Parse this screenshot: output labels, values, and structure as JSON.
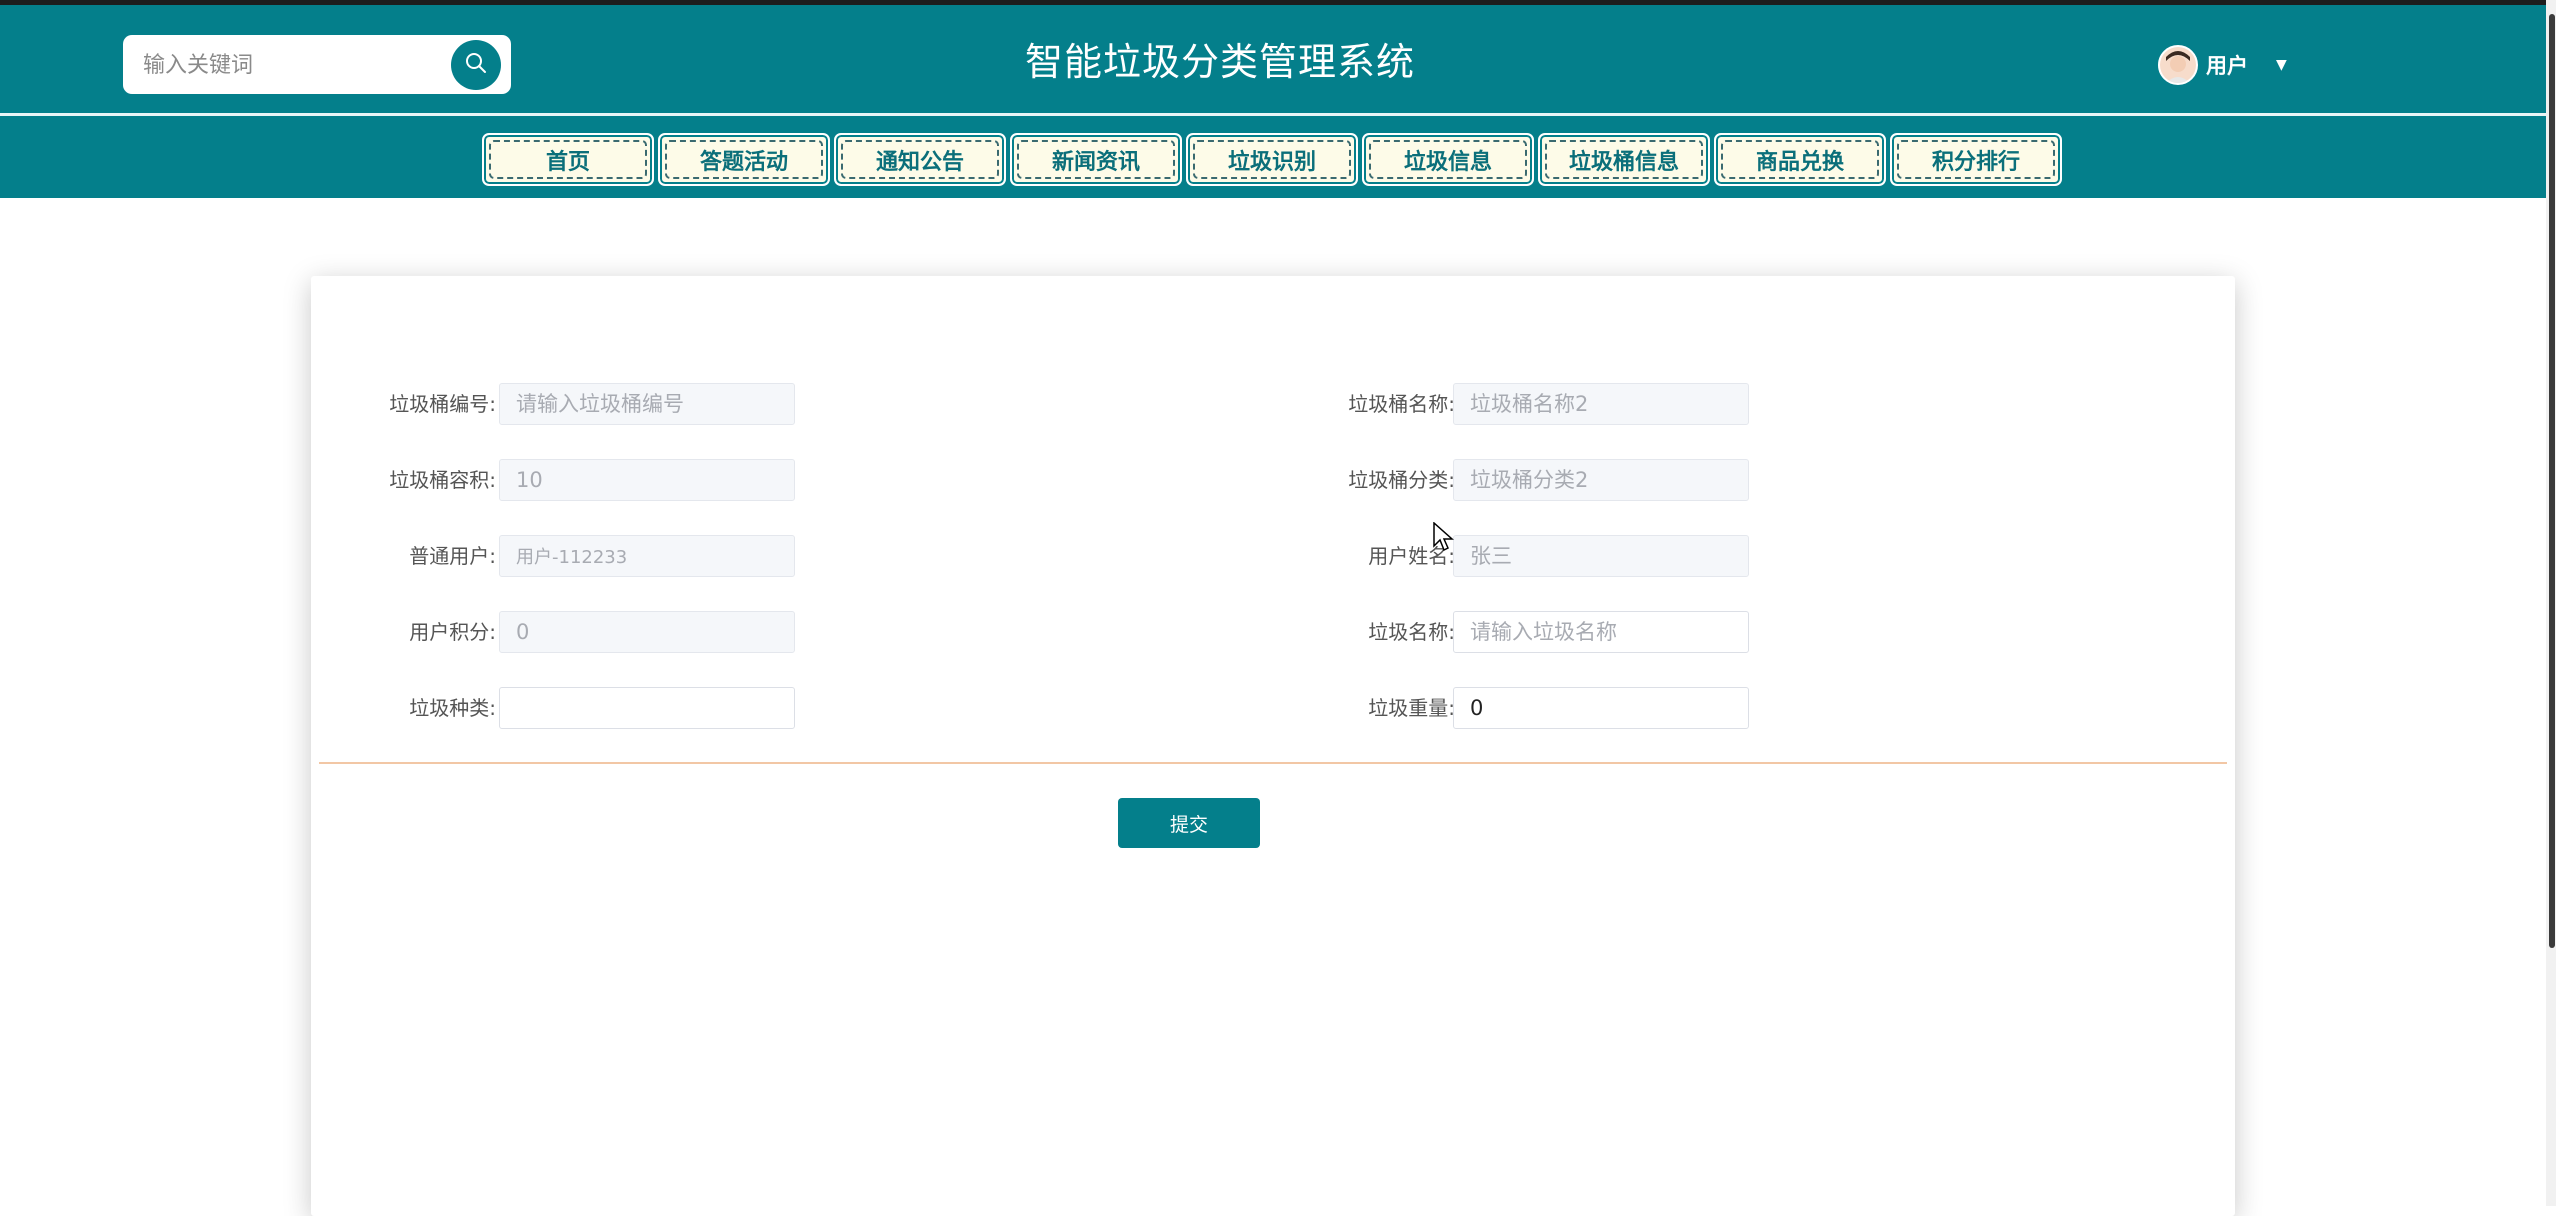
{
  "header": {
    "site_title": "智能垃圾分类管理系统",
    "search_placeholder": "输入关键词",
    "user_label": "用户",
    "brand_color": "#047f8b"
  },
  "nav": {
    "items": [
      {
        "label": "首页"
      },
      {
        "label": "答题活动"
      },
      {
        "label": "通知公告"
      },
      {
        "label": "新闻资讯"
      },
      {
        "label": "垃圾识别"
      },
      {
        "label": "垃圾信息"
      },
      {
        "label": "垃圾桶信息"
      },
      {
        "label": "商品兑换"
      },
      {
        "label": "积分排行"
      }
    ]
  },
  "form": {
    "bin_number": {
      "label": "垃圾桶编号:",
      "value": "",
      "placeholder": "请输入垃圾桶编号"
    },
    "bin_name": {
      "label": "垃圾桶名称:",
      "value": "",
      "placeholder": "垃圾桶名称2"
    },
    "bin_capacity": {
      "label": "垃圾桶容积:",
      "value": "10",
      "placeholder": ""
    },
    "bin_category": {
      "label": "垃圾桶分类:",
      "value": "",
      "placeholder": "垃圾桶分类2"
    },
    "regular_user": {
      "label": "普通用户:",
      "value": "用户-112233",
      "placeholder": ""
    },
    "user_name": {
      "label": "用户姓名:",
      "value": "",
      "placeholder": "张三"
    },
    "user_points": {
      "label": "用户积分:",
      "value": "0",
      "placeholder": ""
    },
    "garbage_name": {
      "label": "垃圾名称:",
      "value": "",
      "placeholder": "请输入垃圾名称"
    },
    "garbage_type": {
      "label": "垃圾种类:",
      "value": "",
      "placeholder": ""
    },
    "garbage_weight": {
      "label": "垃圾重量:",
      "value": "0",
      "placeholder": ""
    },
    "submit_label": "提交"
  }
}
